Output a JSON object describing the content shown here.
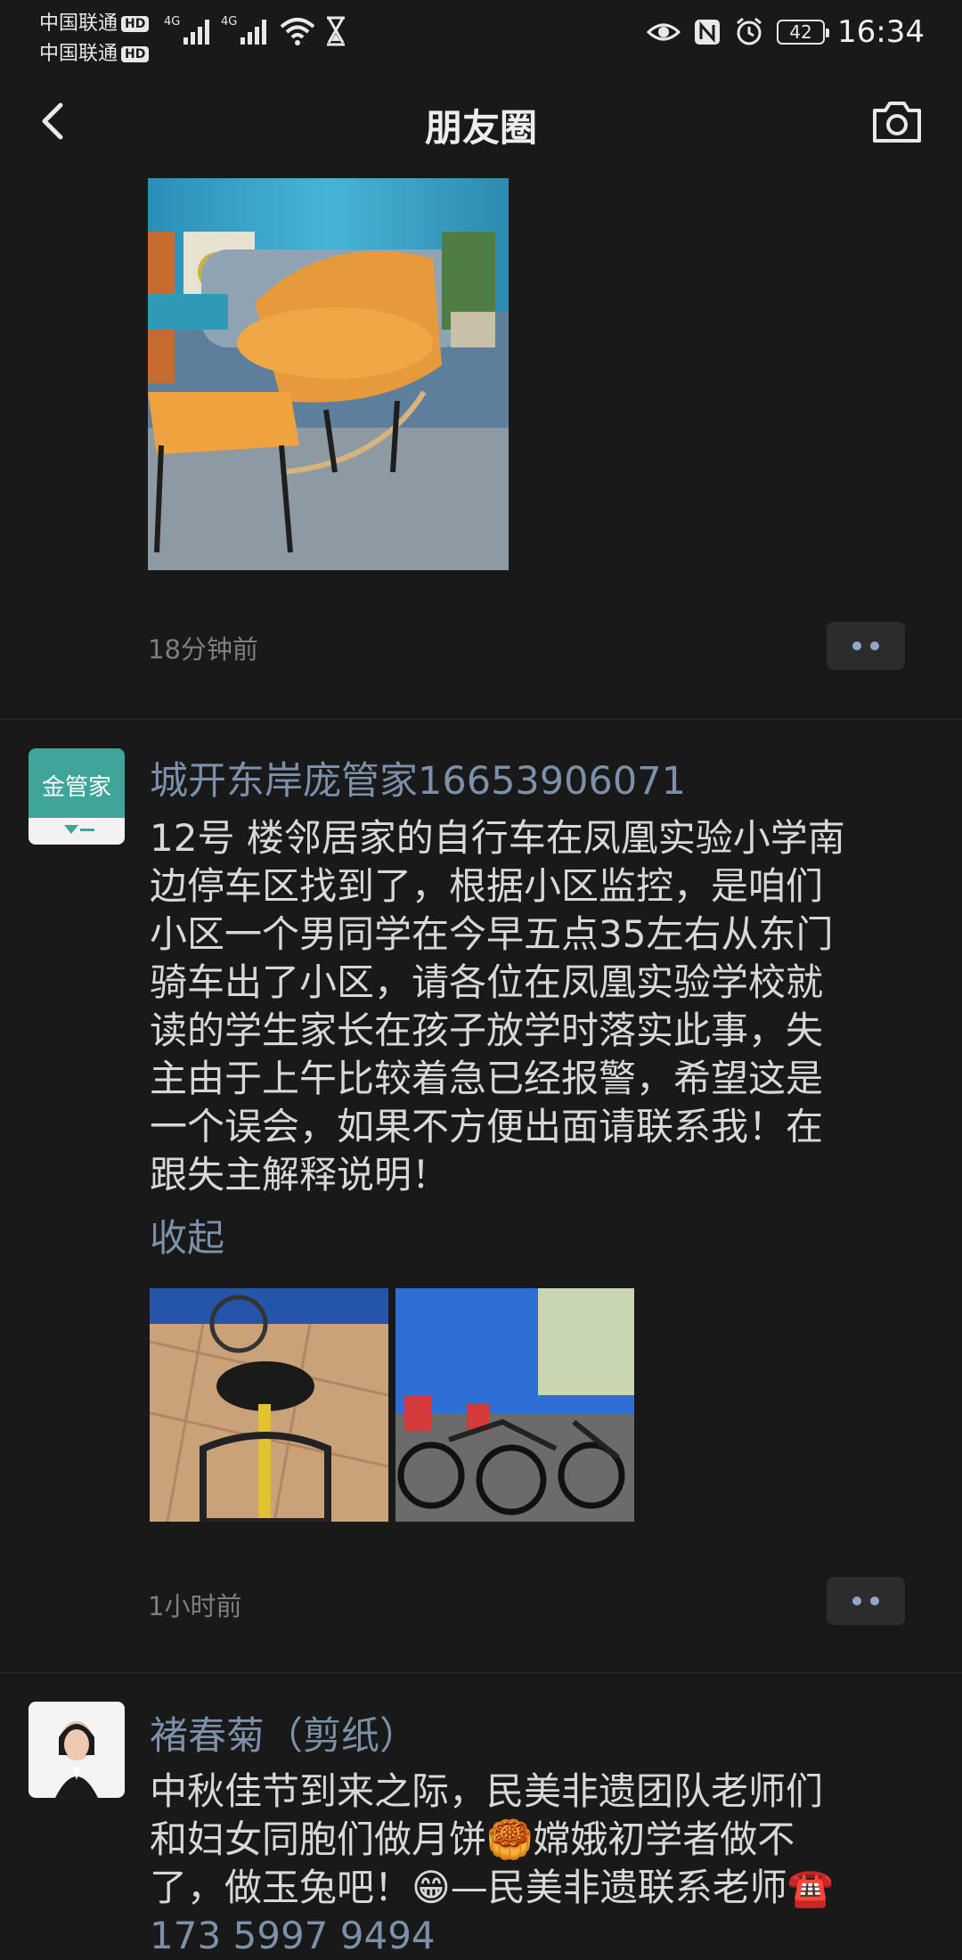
{
  "status_bar": {
    "carrier1": "中国联通",
    "carrier2": "中国联通",
    "hd_badge": "HD",
    "network1": "4G",
    "network2": "4G",
    "battery_level": "42",
    "time": "16:34"
  },
  "nav": {
    "title": "朋友圈",
    "back_icon": "chevron-left-icon",
    "camera_icon": "camera-icon"
  },
  "posts": [
    {
      "time": "18分钟前"
    },
    {
      "username": "城开东岸庞管家16653906071",
      "avatar_text": "金管家",
      "text_lines": [
        "12号 楼邻居家的自行车在凤凰实验小学南",
        "边停车区找到了，根据小区监控，是咱们",
        "小区一个男同学在今早五点35左右从东门",
        "骑车出了小区，请各位在凤凰实验学校就",
        "读的学生家长在孩子放学时落实此事，失",
        "主由于上午比较着急已经报警，希望这是",
        "一个误会，如果不方便出面请联系我！在",
        "跟失主解释说明！"
      ],
      "collapse_label": "收起",
      "time": "1小时前"
    },
    {
      "username": "褚春菊（剪纸）",
      "text_lines": [
        "中秋佳节到来之际，民美非遗团队老师们",
        "和妇女同胞们做月饼🥮嫦娥初学者做不",
        "了，做玉兔吧！😁—民美非遗联系老师☎️",
        "173 5997 9494"
      ]
    }
  ],
  "colors": {
    "background": "#191919",
    "link": "#7d90a9",
    "text": "#d8d8d8",
    "meta": "#7e7e7e"
  }
}
